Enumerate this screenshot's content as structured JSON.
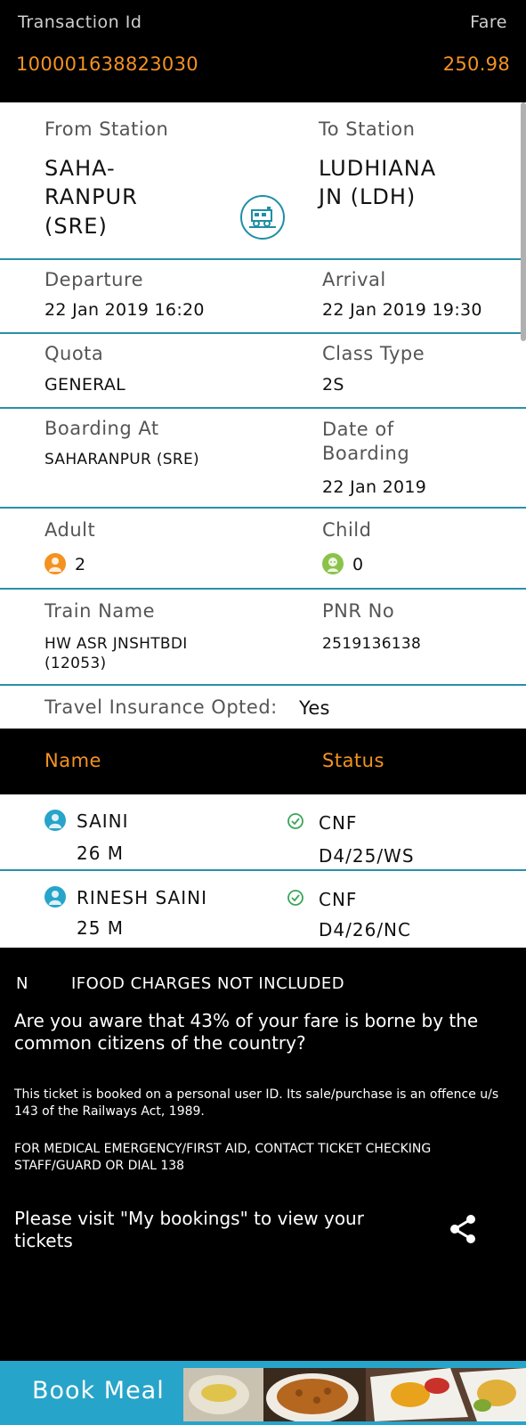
{
  "header": {
    "transaction_label": "Transaction Id",
    "fare_label": "Fare",
    "transaction_id": "100001638823030",
    "fare": "250.98"
  },
  "journey": {
    "from_label": "From Station",
    "from_value_lines": [
      "SAHA-",
      "RANPUR",
      "(SRE)"
    ],
    "to_label": "To Station",
    "to_value_lines": [
      "LUDHIANA",
      "JN (LDH)"
    ],
    "departure_label": "Departure",
    "departure_value": "22 Jan 2019  16:20",
    "arrival_label": "Arrival",
    "arrival_value": "22 Jan 2019  19:30",
    "quota_label": "Quota",
    "quota_value": "GENERAL",
    "class_label": "Class Type",
    "class_value": "2S",
    "boarding_label": "Boarding At",
    "boarding_value": "SAHARANPUR (SRE)",
    "date_boarding_label_lines": [
      "Date of",
      "Boarding"
    ],
    "date_boarding_value": "22 Jan 2019",
    "adult_label": "Adult",
    "adult_value": "2",
    "child_label": "Child",
    "child_value": "0",
    "train_name_label": "Train Name",
    "train_name_lines": [
      "HW ASR JNSHTBDI",
      "(12053)"
    ],
    "pnr_label": "PNR No",
    "pnr_value": "2519136138",
    "insurance_label": "Travel Insurance Opted:",
    "insurance_value": "Yes"
  },
  "passenger_table": {
    "name_header": "Name",
    "status_header": "Status",
    "rows": [
      {
        "name": "SAINI",
        "age_gender": "26 M",
        "status": "CNF",
        "seat": "D4/25/WS"
      },
      {
        "name": "RINESH SAINI",
        "age_gender": "25 M",
        "status": "CNF",
        "seat": "D4/26/NC"
      }
    ]
  },
  "info": {
    "n_text": "N",
    "food_text": "IFOOD CHARGES NOT INCLUDED",
    "question": "Are you aware that 43% of your fare is borne by the common citizens of the country?",
    "notice": "This ticket is booked on a personal user ID. Its sale/purchase is an offence u/s 143 of the Railways Act, 1989.",
    "medical": "FOR MEDICAL EMERGENCY/FIRST AID, CONTACT TICKET CHECKING STAFF/GUARD OR DIAL 138",
    "visit": "Please visit \"My bookings\" to view your tickets"
  },
  "banner": {
    "label": "Book Meal"
  },
  "colors": {
    "accent_orange": "#f39221",
    "divider_teal": "#2a90a8",
    "banner_blue": "#27a4c9",
    "status_green": "#3aa55a"
  },
  "icons": [
    "train-icon",
    "adult-icon",
    "child-icon",
    "passenger-icon",
    "check-circle-icon",
    "share-icon"
  ]
}
